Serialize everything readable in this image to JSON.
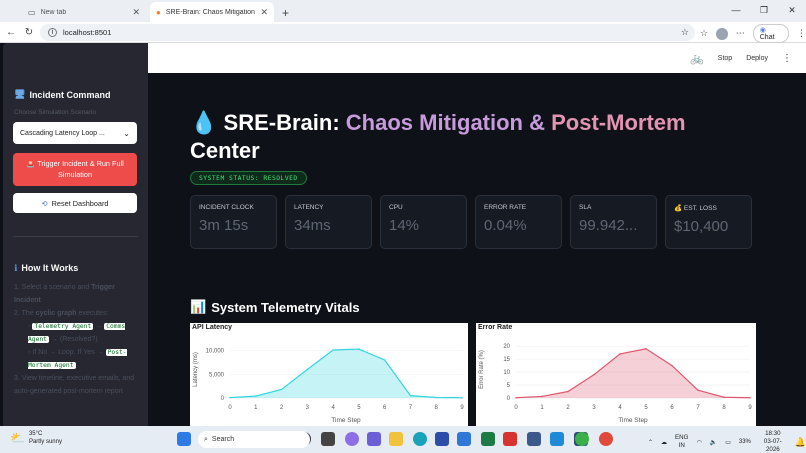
{
  "browser": {
    "tabs": [
      {
        "label": "New tab",
        "active": false
      },
      {
        "label": "SRE-Brain: Chaos Mitigation Cente",
        "active": true
      }
    ],
    "url": "localhost:8501",
    "chat_label": "Chat"
  },
  "toolbar": {
    "stop_label": "Stop",
    "deploy_label": "Deploy"
  },
  "sidebar": {
    "heading": "Incident Command",
    "select_label": "Choose Simulation Scenario",
    "selected_scenario": "Cascading Latency Loop ...",
    "trigger_button": "Trigger Incident & Run Full Simulation",
    "reset_button": "Reset Dashboard",
    "how_heading": "How It Works",
    "step1_a": "Select a scenario and ",
    "step1_b": "Trigger Incident",
    "step2_a": "The ",
    "step2_b": "cyclic graph",
    "step2_c": " executes:",
    "code1": "Telemetry Agent",
    "code2": "Comms Agent",
    "resolved_text": "(Resolved?)",
    "loop_text": "If No → Loop. If Yes →",
    "code3": "Post-Mortem Agent",
    "step3": "View timeline, executive emails, and auto-generated post-mortem report"
  },
  "header": {
    "title_a": "SRE-Brain: ",
    "title_b": "Chaos Mitigation &",
    "title_c": "Post-Mortem",
    "title_d": "Center",
    "status": "SYSTEM STATUS: RESOLVED"
  },
  "metrics": [
    {
      "label": "INCIDENT CLOCK",
      "value": "3m 15s"
    },
    {
      "label": "LATENCY",
      "value": "34ms"
    },
    {
      "label": "CPU",
      "value": "14%"
    },
    {
      "label": "ERROR RATE",
      "value": "0.04%"
    },
    {
      "label": "SLA",
      "value": "99.942..."
    },
    {
      "label": "EST. LOSS",
      "value": "$10,400"
    }
  ],
  "telemetry_heading": "System Telemetry Vitals",
  "chart_data": [
    {
      "type": "area",
      "title": "API Latency",
      "xlabel": "Time Step",
      "ylabel": "Latency (ms)",
      "x": [
        0,
        1,
        2,
        3,
        4,
        5,
        6,
        7,
        8,
        9
      ],
      "values": [
        80,
        400,
        1800,
        6000,
        10100,
        10300,
        8000,
        500,
        100,
        50
      ],
      "ylim": [
        0,
        12000
      ],
      "yticks": [
        "10,000",
        "5,000",
        "0"
      ],
      "color": "#33d6e0"
    },
    {
      "type": "area",
      "title": "Error Rate",
      "xlabel": "Time Step",
      "ylabel": "Error Rate (%)",
      "x": [
        0,
        1,
        2,
        3,
        4,
        5,
        6,
        7,
        8,
        9
      ],
      "values": [
        0.1,
        0.6,
        2.5,
        9,
        17,
        19,
        12.5,
        3,
        0.3,
        0.1
      ],
      "ylim": [
        0,
        22
      ],
      "yticks": [
        "20",
        "15",
        "10",
        "5",
        "0"
      ],
      "color": "#e0576e"
    }
  ],
  "taskbar": {
    "temp": "35°C",
    "weather": "Partly sunny",
    "search": "Search",
    "lang1": "ENG",
    "lang2": "IN",
    "battery": "33%",
    "time": "18:30",
    "date": "03-07-2026"
  }
}
